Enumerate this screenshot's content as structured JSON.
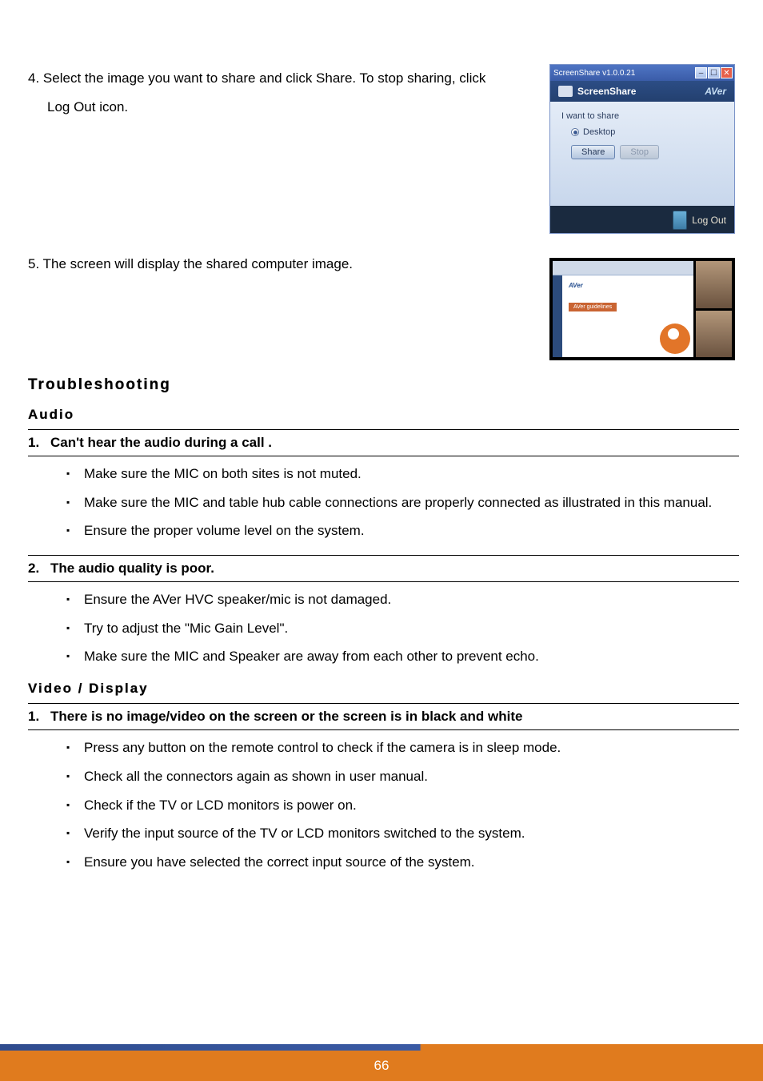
{
  "steps": {
    "s4": {
      "num": "4.",
      "text": "Select the image you want to share and click Share. To stop sharing, click Log Out icon."
    },
    "s5": {
      "num": "5.",
      "text": "The screen will display the shared computer image."
    }
  },
  "ssapp": {
    "winTitle": "ScreenShare v1.0.0.21",
    "header": "ScreenShare",
    "brand": "AVer",
    "sectionLabel": "I want to share",
    "radioLabel": "Desktop",
    "shareBtn": "Share",
    "stopBtn": "Stop",
    "logout": "Log Out"
  },
  "shared": {
    "title": "AVer",
    "subtitle": "AVer guidelines"
  },
  "troubleshooting": {
    "heading": "Troubleshooting",
    "audio": {
      "heading": "Audio",
      "q1": {
        "num": "1.",
        "text": "Can't hear the audio during a call .",
        "bullets": [
          "Make sure the MIC on both sites is not muted.",
          "Make sure the MIC and table hub cable connections are properly connected as illustrated in this manual.",
          "Ensure the proper volume level on the system."
        ]
      },
      "q2": {
        "num": "2.",
        "text": "The audio quality is poor.",
        "bullets": [
          "Ensure the AVer HVC speaker/mic is not damaged.",
          "Try to adjust the \"Mic Gain Level\".",
          "Make sure the MIC and Speaker are away from each other to prevent echo."
        ]
      }
    },
    "video": {
      "heading": "Video / Display",
      "q1": {
        "num": "1.",
        "text": "There is no image/video on the screen or the screen is in black and white",
        "bullets": [
          "Press any button on the remote control to check if the camera is in sleep mode.",
          "Check all the connectors again as shown in user manual.",
          "Check if the TV or LCD monitors is power on.",
          "Verify the input source of the TV or LCD monitors switched to the system.",
          "Ensure you have selected the correct input source of the system."
        ]
      }
    }
  },
  "page": {
    "number": "66"
  }
}
